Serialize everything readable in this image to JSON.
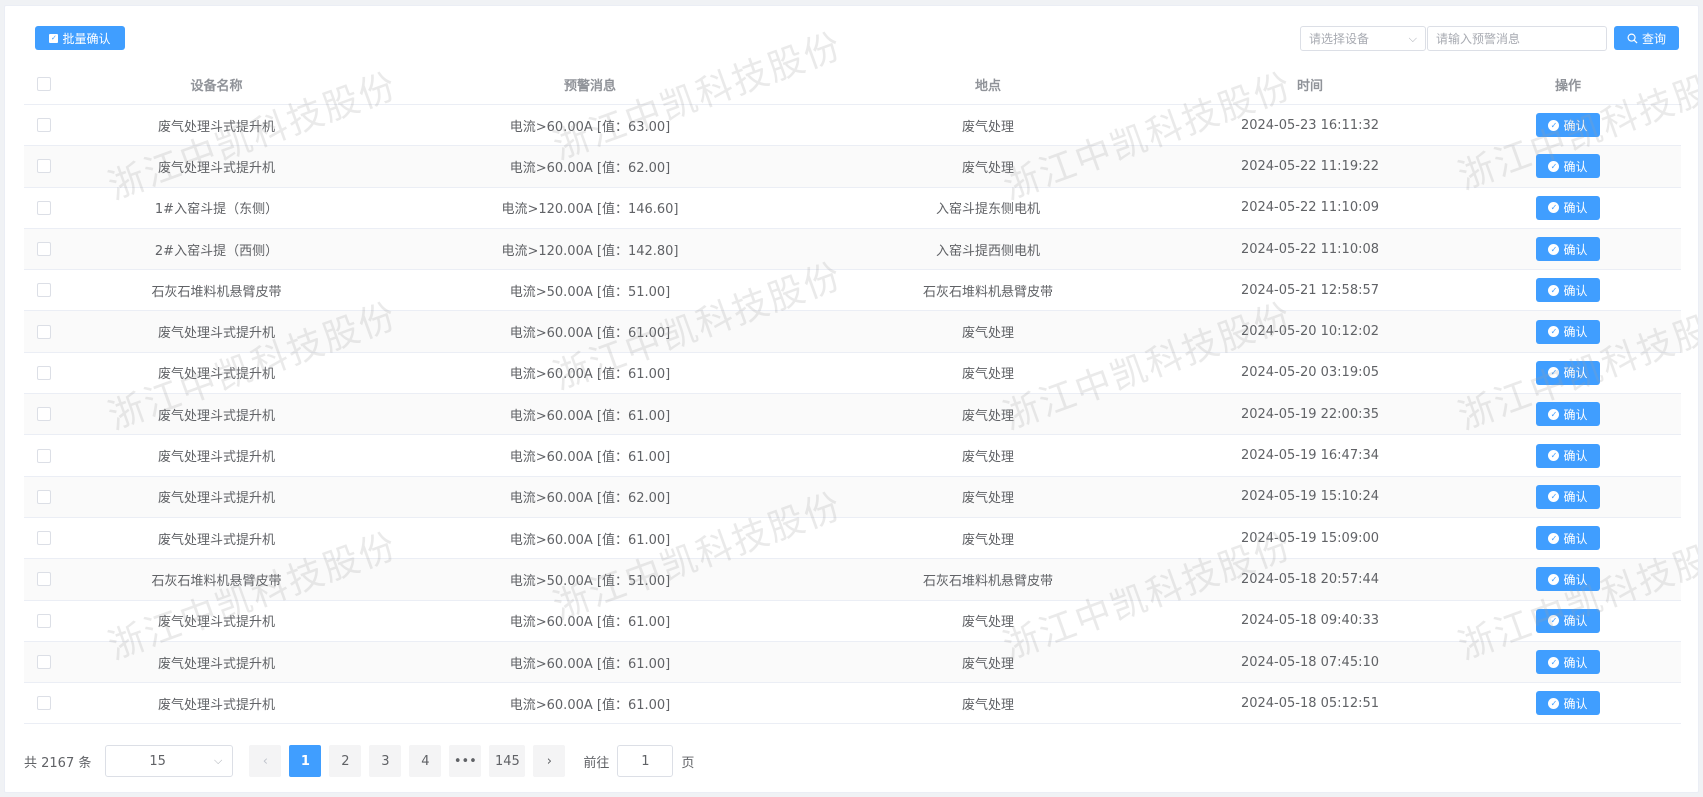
{
  "toolbar": {
    "batch_confirm_label": "批量确认",
    "device_select_placeholder": "请选择设备",
    "message_input_placeholder": "请输入预警消息",
    "query_label": "查询"
  },
  "watermark_text": "浙江中凯科技股份",
  "table": {
    "headers": {
      "name": "设备名称",
      "message": "预警消息",
      "location": "地点",
      "time": "时间",
      "operation": "操作"
    },
    "confirm_label": "确认",
    "rows": [
      {
        "name": "废气处理斗式提升机",
        "message": "电流>60.00A [值：63.00]",
        "location": "废气处理",
        "time": "2024-05-23 16:11:32"
      },
      {
        "name": "废气处理斗式提升机",
        "message": "电流>60.00A [值：62.00]",
        "location": "废气处理",
        "time": "2024-05-22 11:19:22"
      },
      {
        "name": "1#入窑斗提（东侧）",
        "message": "电流>120.00A [值：146.60]",
        "location": "入窑斗提东侧电机",
        "time": "2024-05-22 11:10:09"
      },
      {
        "name": "2#入窑斗提（西侧）",
        "message": "电流>120.00A [值：142.80]",
        "location": "入窑斗提西侧电机",
        "time": "2024-05-22 11:10:08"
      },
      {
        "name": "石灰石堆料机悬臂皮带",
        "message": "电流>50.00A [值：51.00]",
        "location": "石灰石堆料机悬臂皮带",
        "time": "2024-05-21 12:58:57"
      },
      {
        "name": "废气处理斗式提升机",
        "message": "电流>60.00A [值：61.00]",
        "location": "废气处理",
        "time": "2024-05-20 10:12:02"
      },
      {
        "name": "废气处理斗式提升机",
        "message": "电流>60.00A [值：61.00]",
        "location": "废气处理",
        "time": "2024-05-20 03:19:05"
      },
      {
        "name": "废气处理斗式提升机",
        "message": "电流>60.00A [值：61.00]",
        "location": "废气处理",
        "time": "2024-05-19 22:00:35"
      },
      {
        "name": "废气处理斗式提升机",
        "message": "电流>60.00A [值：61.00]",
        "location": "废气处理",
        "time": "2024-05-19 16:47:34"
      },
      {
        "name": "废气处理斗式提升机",
        "message": "电流>60.00A [值：62.00]",
        "location": "废气处理",
        "time": "2024-05-19 15:10:24"
      },
      {
        "name": "废气处理斗式提升机",
        "message": "电流>60.00A [值：61.00]",
        "location": "废气处理",
        "time": "2024-05-19 15:09:00"
      },
      {
        "name": "石灰石堆料机悬臂皮带",
        "message": "电流>50.00A [值：51.00]",
        "location": "石灰石堆料机悬臂皮带",
        "time": "2024-05-18 20:57:44"
      },
      {
        "name": "废气处理斗式提升机",
        "message": "电流>60.00A [值：61.00]",
        "location": "废气处理",
        "time": "2024-05-18 09:40:33"
      },
      {
        "name": "废气处理斗式提升机",
        "message": "电流>60.00A [值：61.00]",
        "location": "废气处理",
        "time": "2024-05-18 07:45:10"
      },
      {
        "name": "废气处理斗式提升机",
        "message": "电流>60.00A [值：61.00]",
        "location": "废气处理",
        "time": "2024-05-18 05:12:51"
      }
    ]
  },
  "pagination": {
    "total_text": "共 2167 条",
    "page_size_value": "15",
    "pages": [
      "1",
      "2",
      "3",
      "4",
      "•••",
      "145"
    ],
    "active_page": "1",
    "goto_label": "前往",
    "goto_value": "1",
    "page_suffix": "页"
  },
  "icons": {
    "batch": "check-square-icon",
    "query": "search-icon",
    "confirm": "check-circle-icon",
    "select_arrow": "chevron-down-icon",
    "prev": "chevron-left-icon",
    "next": "chevron-right-icon"
  },
  "colors": {
    "primary": "#409eff",
    "header_text": "#909399",
    "body_text": "#606266",
    "border": "#ebeef5"
  }
}
